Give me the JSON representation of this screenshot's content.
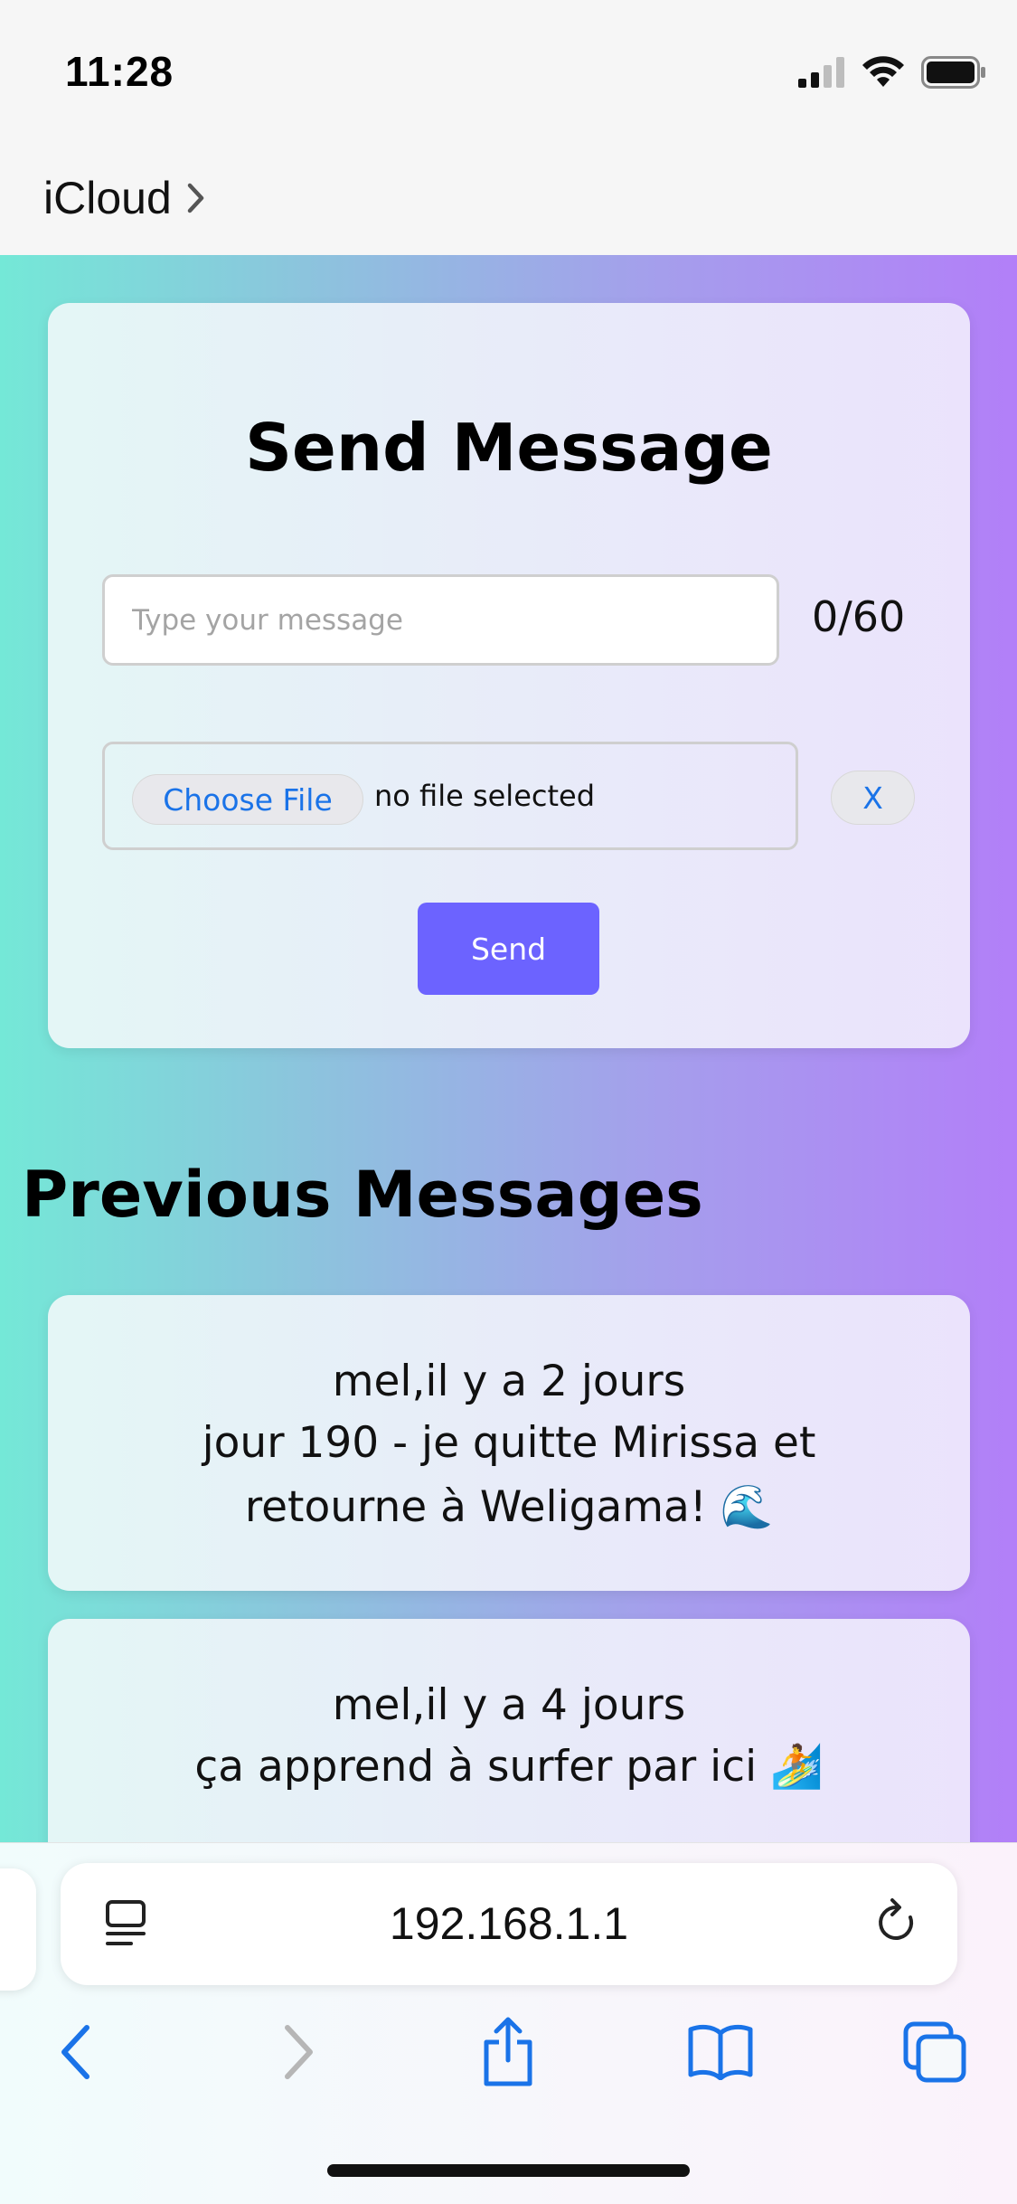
{
  "status_bar": {
    "time": "11:28"
  },
  "nav": {
    "back_app_label": "iCloud"
  },
  "send_form": {
    "title": "Send Message",
    "message_placeholder": "Type your message",
    "message_value": "",
    "char_counter": "0/60",
    "choose_file_label": "Choose File",
    "file_status": "no file selected",
    "clear_file_label": "X",
    "send_label": "Send"
  },
  "previous": {
    "title": "Previous Messages",
    "messages": [
      {
        "meta": "mel,il y a 2 jours",
        "text": "jour 190 - je quitte Mirissa et retourne à Weligama! 🌊"
      },
      {
        "meta": "mel,il y a 4 jours",
        "text": "ça apprend à surfer par ici 🏄"
      }
    ]
  },
  "browser": {
    "url": "192.168.1.1"
  },
  "colors": {
    "accent": "#6c63ff",
    "link_blue": "#1a73e8",
    "gradient_start": "#74e8d7",
    "gradient_end": "#b27ff8"
  },
  "icons": [
    "signal-icon",
    "wifi-icon",
    "battery-icon",
    "chevron-right-icon",
    "page-menu-icon",
    "reload-icon",
    "back-icon",
    "forward-icon",
    "share-icon",
    "bookmarks-icon",
    "tabs-icon"
  ]
}
